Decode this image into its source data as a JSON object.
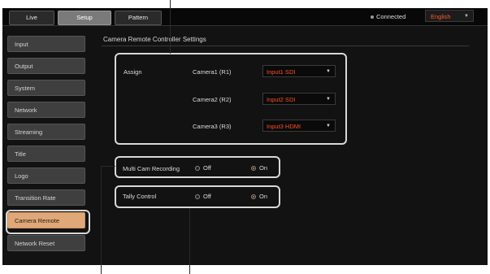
{
  "tabs": [
    {
      "label": "Live",
      "active": false
    },
    {
      "label": "Setup",
      "active": true
    },
    {
      "label": "Pattern",
      "active": false
    }
  ],
  "status": {
    "connection": "Connected",
    "language": "English"
  },
  "sidebar": {
    "items": [
      {
        "label": "Input"
      },
      {
        "label": "Output"
      },
      {
        "label": "System"
      },
      {
        "label": "Network"
      },
      {
        "label": "Streaming"
      },
      {
        "label": "Title"
      },
      {
        "label": "Logo"
      },
      {
        "label": "Transition Rate"
      },
      {
        "label": "Camera Remote",
        "active": true
      },
      {
        "label": "Network Reset"
      }
    ]
  },
  "main": {
    "title": "Camera Remote Controller Settings",
    "assign": {
      "label": "Assign",
      "rows": [
        {
          "camera": "Camera1 (R1)",
          "value": "Input1 SDI"
        },
        {
          "camera": "Camera2 (R2)",
          "value": "Input2 SDI"
        },
        {
          "camera": "Camera3 (R3)",
          "value": "Input3 HDMI"
        }
      ]
    },
    "multicam": {
      "label": "Multi Cam Recording",
      "off": "Off",
      "on": "On",
      "selected": "On"
    },
    "tally": {
      "label": "Tally Control",
      "off": "Off",
      "on": "On",
      "selected": "On"
    }
  },
  "colors": {
    "accent": "#ff4f1f",
    "active_sidebar": "#e0a878",
    "panel": "#121212"
  }
}
